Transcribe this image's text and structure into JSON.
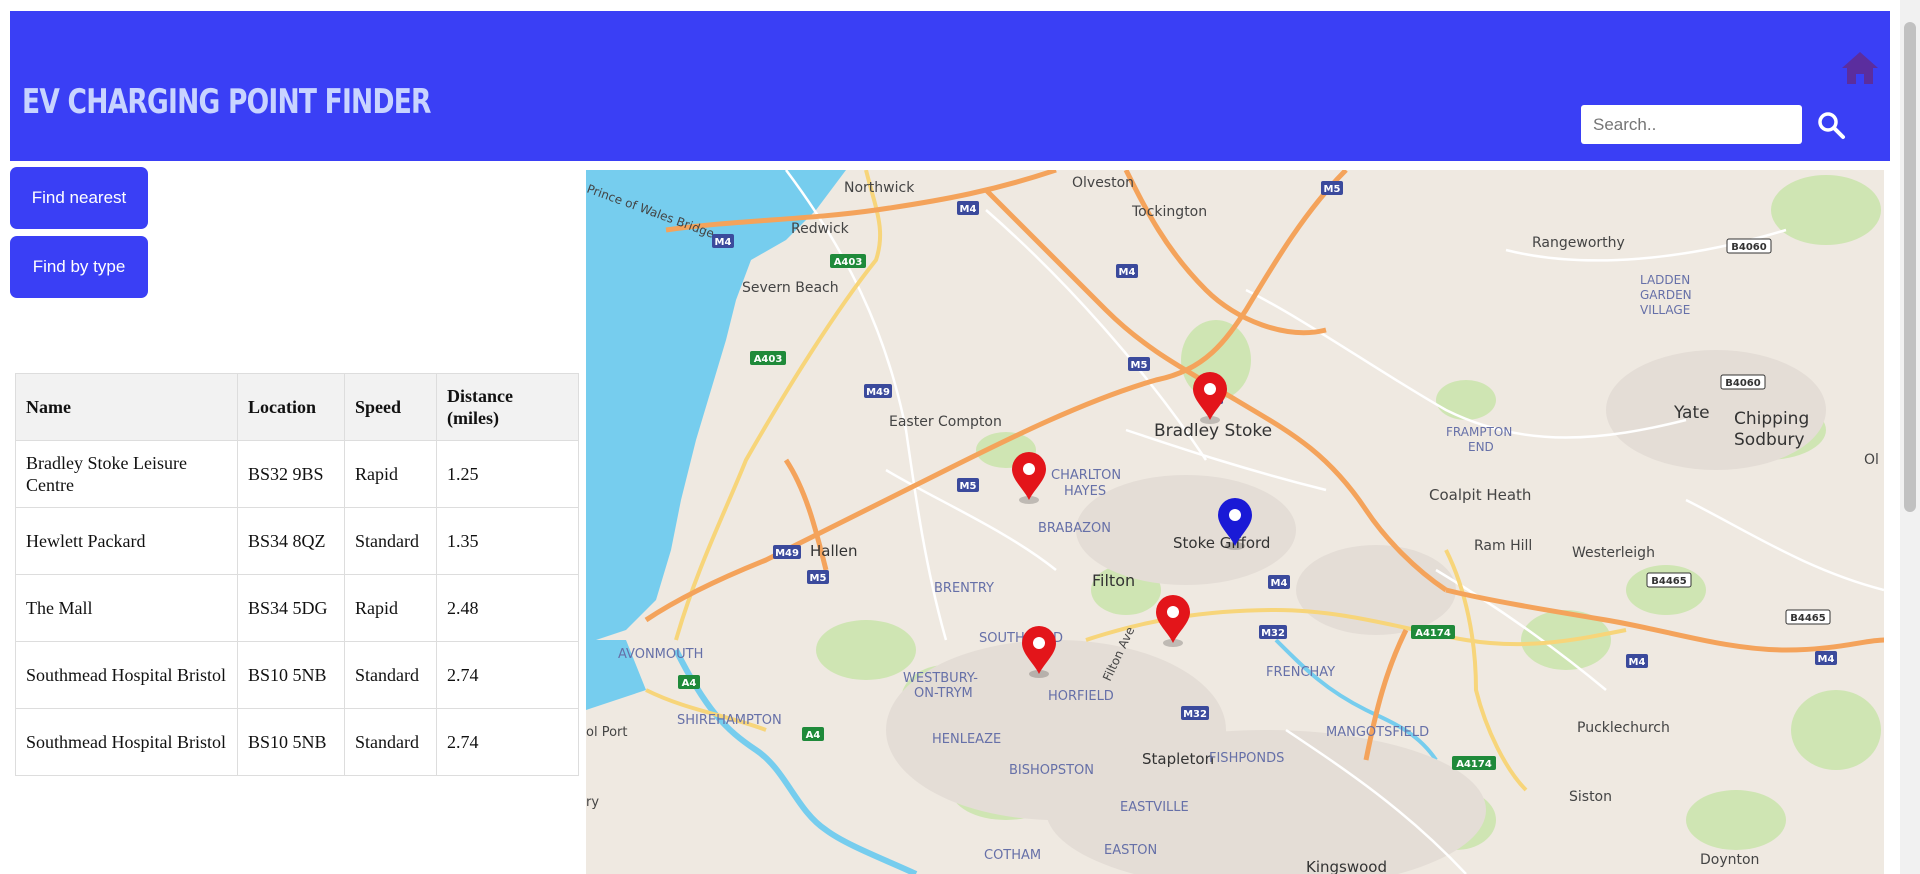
{
  "header": {
    "title": "EV Charging Point Finder",
    "search_placeholder": "Search.."
  },
  "buttons": {
    "find_nearest": "Find nearest",
    "find_by_type": "Find by type"
  },
  "table": {
    "headers": [
      "Name",
      "Location",
      "Speed",
      "Distance (miles)"
    ],
    "rows": [
      {
        "name": "Bradley Stoke Leisure Centre",
        "location": "BS32 9BS",
        "speed": "Rapid",
        "distance": "1.25"
      },
      {
        "name": "Hewlett Packard",
        "location": "BS34 8QZ",
        "speed": "Standard",
        "distance": "1.35"
      },
      {
        "name": "The Mall",
        "location": "BS34 5DG",
        "speed": "Rapid",
        "distance": "2.48"
      },
      {
        "name": "Southmead Hospital Bristol",
        "location": "BS10 5NB",
        "speed": "Standard",
        "distance": "2.74"
      },
      {
        "name": "Southmead Hospital Bristol",
        "location": "BS10 5NB",
        "speed": "Standard",
        "distance": "2.74"
      }
    ]
  },
  "map": {
    "places": [
      "Northwick",
      "Olveston",
      "Tockington",
      "Redwick",
      "Severn Beach",
      "Rangeworthy",
      "Prince of Wales Bridge",
      "LADDEN",
      "GARDEN",
      "VILLAGE",
      "Easter Compton",
      "Bradley Stoke",
      "FRAMPTON",
      "END",
      "Yate",
      "Chipping",
      "Sodbury",
      "CHARLTON",
      "HAYES",
      "BRABAZON",
      "Stoke Gifford",
      "Coalpit Heath",
      "Ram Hill",
      "Westerleigh",
      "Hallen",
      "Filton",
      "BRENTRY",
      "SOUTHMEAD",
      "Filton Ave",
      "FRENCHAY",
      "AVONMOUTH",
      "WESTBURY-",
      "ON-TRYM",
      "HORFIELD",
      "SHIREHAMPTON",
      "MANGOTSFIELD",
      "Pucklechurch",
      "HENLEAZE",
      "Stapleton",
      "FISHPONDS",
      "BISHOPSTON",
      "EASTVILLE",
      "Siston",
      "COTHAM",
      "EASTON",
      "Kingswood",
      "Doynton",
      "Ol",
      "ol Port",
      "ry"
    ],
    "roads": [
      "M4",
      "M4",
      "M5",
      "A403",
      "A403",
      "M4",
      "M5",
      "M49",
      "M4",
      "M5",
      "M49",
      "M5",
      "M4",
      "M32",
      "A4174",
      "M4",
      "M4",
      "B4060",
      "B4060",
      "B4465",
      "B4465",
      "A4",
      "A4",
      "M32",
      "A4174"
    ],
    "colors": {
      "header": "#3a3ff5",
      "title": "#c8d4ff",
      "home": "#5b2d9e",
      "charger_pin": "#e3151a",
      "user_pin": "#1a1ad6",
      "water": "#76cdee",
      "land": "#efe9e1",
      "green": "#cfe5b3",
      "motorway": "#f4a35b"
    },
    "markers": [
      {
        "type": "charger",
        "label": "Bradley Stoke Leisure Centre"
      },
      {
        "type": "charger",
        "label": "Charlton Hayes"
      },
      {
        "type": "user",
        "label": "Current location"
      },
      {
        "type": "charger",
        "label": "The Mall"
      },
      {
        "type": "charger",
        "label": "Southmead Hospital Bristol"
      }
    ]
  }
}
